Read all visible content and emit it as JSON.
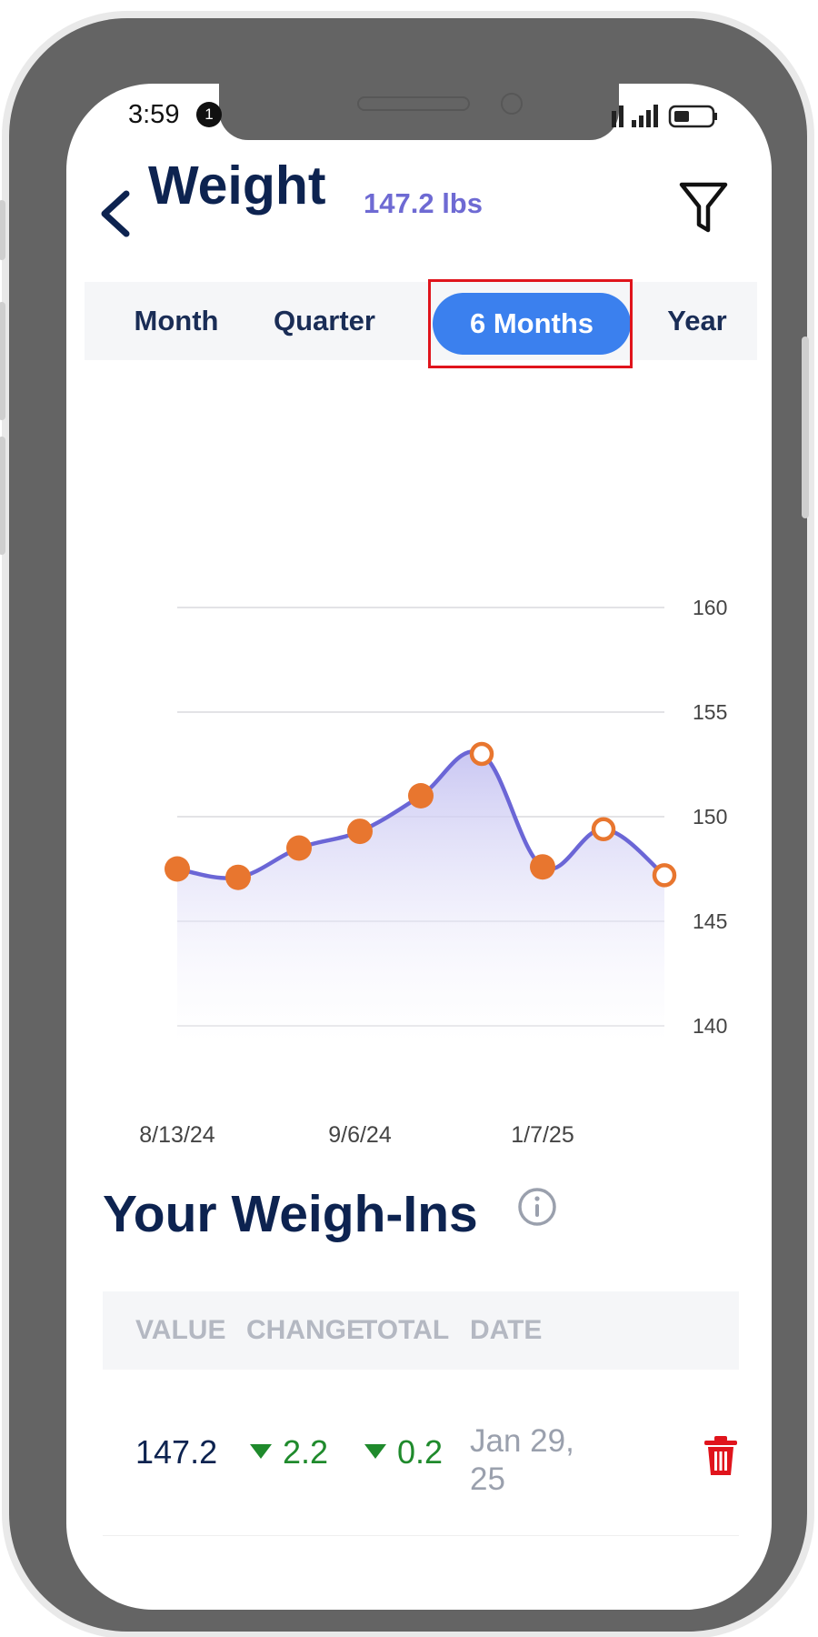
{
  "status": {
    "time": "3:59",
    "notification_count": "1"
  },
  "header": {
    "title": "Weight",
    "current_value": "147.2 lbs"
  },
  "tabs": [
    {
      "label": "Month",
      "selected": false
    },
    {
      "label": "Quarter",
      "selected": false
    },
    {
      "label": "6 Months",
      "selected": true
    },
    {
      "label": "Year",
      "selected": false
    }
  ],
  "chart_data": {
    "type": "area",
    "title": "",
    "xlabel": "",
    "ylabel": "",
    "y_ticks": [
      160,
      155,
      150,
      145,
      140
    ],
    "x_tick_labels": [
      "8/13/24",
      "9/6/24",
      "1/7/25"
    ],
    "ylim": [
      140,
      160
    ],
    "grid": true,
    "y_axis_side": "right",
    "colors": {
      "line": "#6b66d6",
      "fill_top": "#c9c6f2",
      "point": "#e8762f"
    },
    "points": [
      {
        "y": 147.5,
        "style": "filled"
      },
      {
        "y": 147.1,
        "style": "filled"
      },
      {
        "y": 148.5,
        "style": "filled"
      },
      {
        "y": 149.3,
        "style": "filled"
      },
      {
        "y": 151.0,
        "style": "filled"
      },
      {
        "y": 153.0,
        "style": "hollow"
      },
      {
        "y": 147.6,
        "style": "filled"
      },
      {
        "y": 149.4,
        "style": "hollow"
      },
      {
        "y": 147.2,
        "style": "hollow"
      }
    ]
  },
  "weigh_ins": {
    "title": "Your Weigh-Ins",
    "columns": [
      "VALUE",
      "CHANGE",
      "TOTAL",
      "DATE"
    ],
    "rows": [
      {
        "value": "147.2",
        "change": "2.2",
        "total": "0.2",
        "date": "Jan 29, 25"
      }
    ]
  },
  "colors": {
    "accent": "#3b80ee",
    "title": "#0d2350",
    "down": "#1f8a2c",
    "delete": "#e0141c",
    "highlight_box": "#e0141c"
  }
}
